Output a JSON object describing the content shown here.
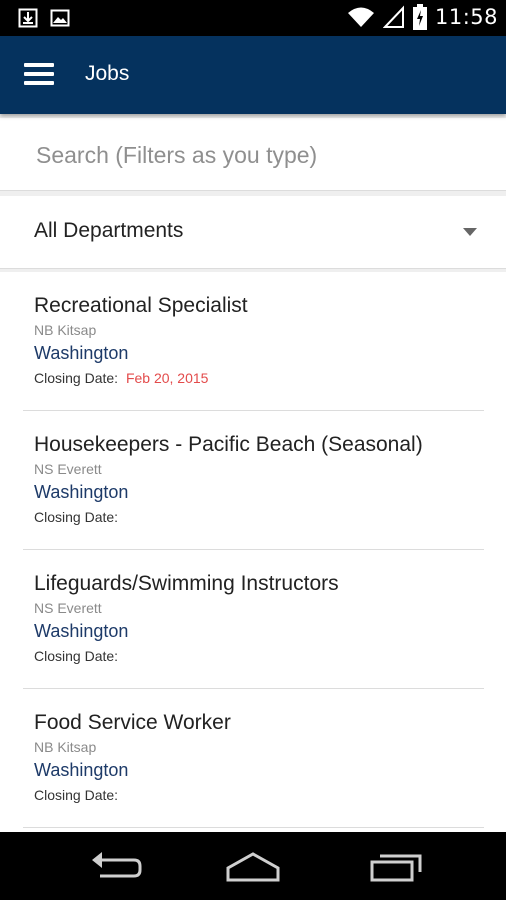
{
  "status_bar": {
    "time": "11:58",
    "icons": [
      "download-icon",
      "image-icon",
      "wifi-icon",
      "signal-icon",
      "battery-charging-icon"
    ]
  },
  "app_bar": {
    "title": "Jobs",
    "menu_icon": "hamburger-menu-icon"
  },
  "search": {
    "placeholder": "Search (Filters as you type)",
    "value": ""
  },
  "department_filter": {
    "selected": "All Departments",
    "icon": "dropdown-arrow-icon"
  },
  "jobs": [
    {
      "title": "Recreational Specialist",
      "base": "NB Kitsap",
      "state": "Washington",
      "closing_label": "Closing Date:",
      "closing_date": "Feb 20, 2015"
    },
    {
      "title": "Housekeepers - Pacific Beach (Seasonal)",
      "base": "NS Everett",
      "state": "Washington",
      "closing_label": "Closing Date:",
      "closing_date": ""
    },
    {
      "title": "Lifeguards/Swimming Instructors",
      "base": "NS Everett",
      "state": "Washington",
      "closing_label": "Closing Date:",
      "closing_date": ""
    },
    {
      "title": "Food Service Worker",
      "base": "NB Kitsap",
      "state": "Washington",
      "closing_label": "Closing Date:",
      "closing_date": ""
    }
  ],
  "nav_bar": {
    "buttons": [
      "back-icon",
      "home-icon",
      "recent-apps-icon"
    ]
  },
  "colors": {
    "app_bar": "#05325e",
    "state_text": "#1d3a68",
    "closing_date": "#e34b4b",
    "background": "#efefef"
  }
}
